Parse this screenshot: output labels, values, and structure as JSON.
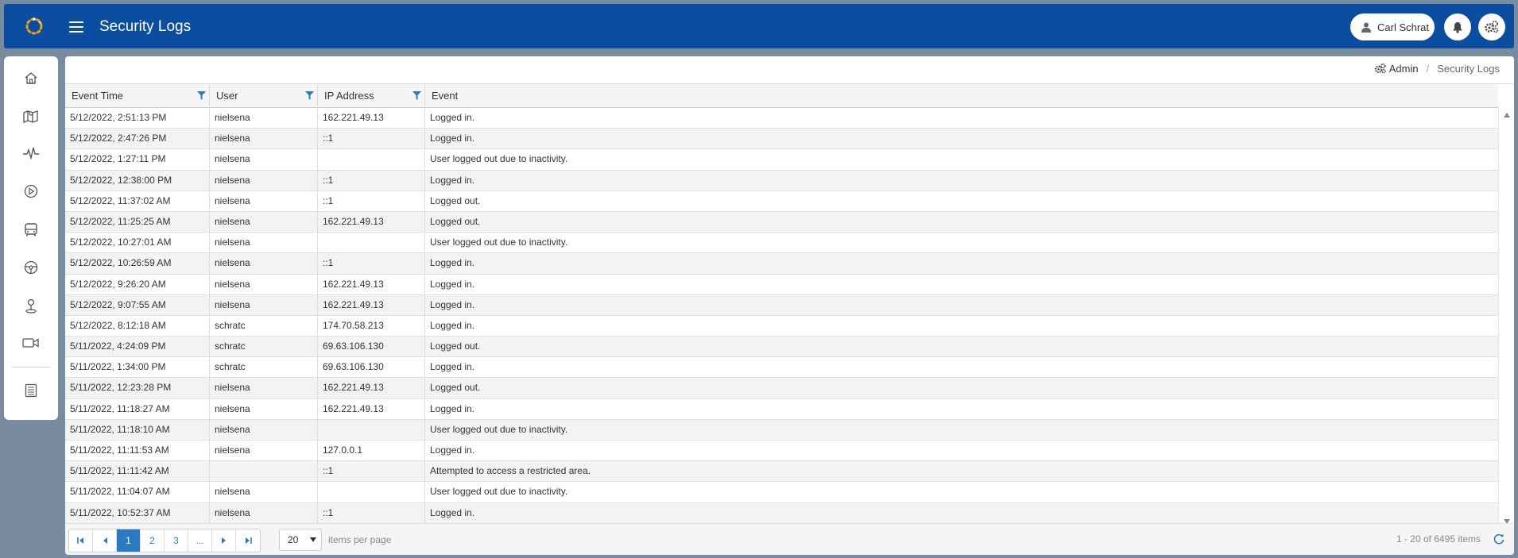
{
  "header": {
    "title": "Security Logs",
    "user_name": "Carl Schrat",
    "brand_color": "#0b4e9f"
  },
  "sidebar": {
    "items": [
      {
        "icon": "home-icon"
      },
      {
        "icon": "map-icon"
      },
      {
        "icon": "activity-icon"
      },
      {
        "icon": "play-icon"
      },
      {
        "icon": "bus-icon"
      },
      {
        "icon": "steering-wheel-icon"
      },
      {
        "icon": "location-pin-icon"
      },
      {
        "icon": "video-camera-icon"
      },
      {
        "icon": "book-icon"
      }
    ]
  },
  "breadcrumb": {
    "admin": "Admin",
    "current": "Security Logs"
  },
  "grid": {
    "columns": [
      "Event Time",
      "User",
      "IP Address",
      "Event"
    ],
    "rows": [
      [
        "5/12/2022, 2:51:13 PM",
        "nielsena",
        "162.221.49.13",
        "Logged in."
      ],
      [
        "5/12/2022, 2:47:26 PM",
        "nielsena",
        "::1",
        "Logged in."
      ],
      [
        "5/12/2022, 1:27:11 PM",
        "nielsena",
        "",
        "User logged out due to inactivity."
      ],
      [
        "5/12/2022, 12:38:00 PM",
        "nielsena",
        "::1",
        "Logged in."
      ],
      [
        "5/12/2022, 11:37:02 AM",
        "nielsena",
        "::1",
        "Logged out."
      ],
      [
        "5/12/2022, 11:25:25 AM",
        "nielsena",
        "162.221.49.13",
        "Logged out."
      ],
      [
        "5/12/2022, 10:27:01 AM",
        "nielsena",
        "",
        "User logged out due to inactivity."
      ],
      [
        "5/12/2022, 10:26:59 AM",
        "nielsena",
        "::1",
        "Logged in."
      ],
      [
        "5/12/2022, 9:26:20 AM",
        "nielsena",
        "162.221.49.13",
        "Logged in."
      ],
      [
        "5/12/2022, 9:07:55 AM",
        "nielsena",
        "162.221.49.13",
        "Logged in."
      ],
      [
        "5/12/2022, 8:12:18 AM",
        "schratc",
        "174.70.58.213",
        "Logged in."
      ],
      [
        "5/11/2022, 4:24:09 PM",
        "schratc",
        "69.63.106.130",
        "Logged out."
      ],
      [
        "5/11/2022, 1:34:00 PM",
        "schratc",
        "69.63.106.130",
        "Logged in."
      ],
      [
        "5/11/2022, 12:23:28 PM",
        "nielsena",
        "162.221.49.13",
        "Logged out."
      ],
      [
        "5/11/2022, 11:18:27 AM",
        "nielsena",
        "162.221.49.13",
        "Logged in."
      ],
      [
        "5/11/2022, 11:18:10 AM",
        "nielsena",
        "",
        "User logged out due to inactivity."
      ],
      [
        "5/11/2022, 11:11:53 AM",
        "nielsena",
        "127.0.0.1",
        "Logged in."
      ],
      [
        "5/11/2022, 11:11:42 AM",
        "",
        "::1",
        "Attempted to access a restricted area."
      ],
      [
        "5/11/2022, 11:04:07 AM",
        "nielsena",
        "",
        "User logged out due to inactivity."
      ],
      [
        "5/11/2022, 10:52:37 AM",
        "nielsena",
        "::1",
        "Logged in."
      ]
    ]
  },
  "pager": {
    "pages": [
      "1",
      "2",
      "3",
      "..."
    ],
    "current_page": "1",
    "page_size": "20",
    "items_per_page_label": "items per page",
    "info": "1 - 20 of 6495 items",
    "accent_color": "#2a7ac2"
  }
}
